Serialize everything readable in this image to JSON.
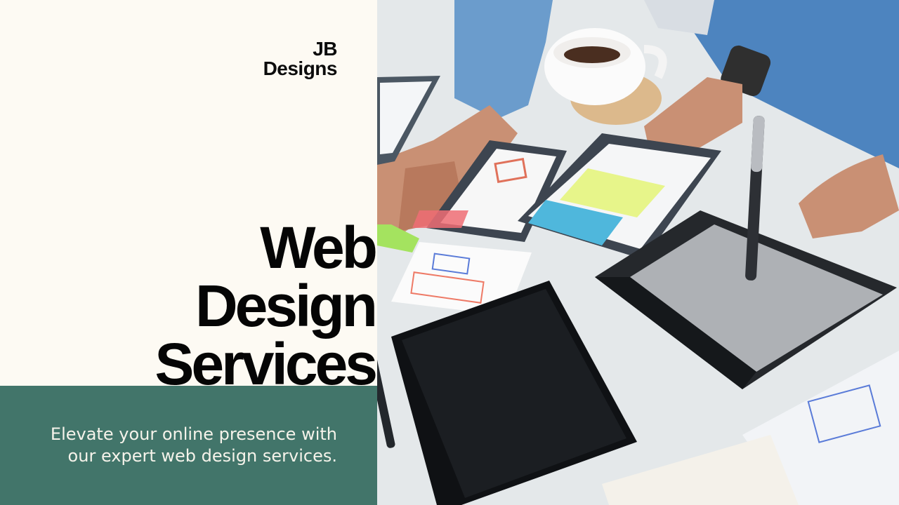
{
  "brand": {
    "line1": "JB",
    "line2": "Designs"
  },
  "headline": {
    "line1": "Web",
    "line2": "Design",
    "line3": "Services"
  },
  "tagline": {
    "line1": "Elevate your online presence with",
    "line2": "our expert web design services."
  },
  "colors": {
    "background": "#fdfaf3",
    "panel": "#42756a",
    "text": "#050505"
  },
  "photo": {
    "subject": "team-collaborating-on-wireframes"
  }
}
